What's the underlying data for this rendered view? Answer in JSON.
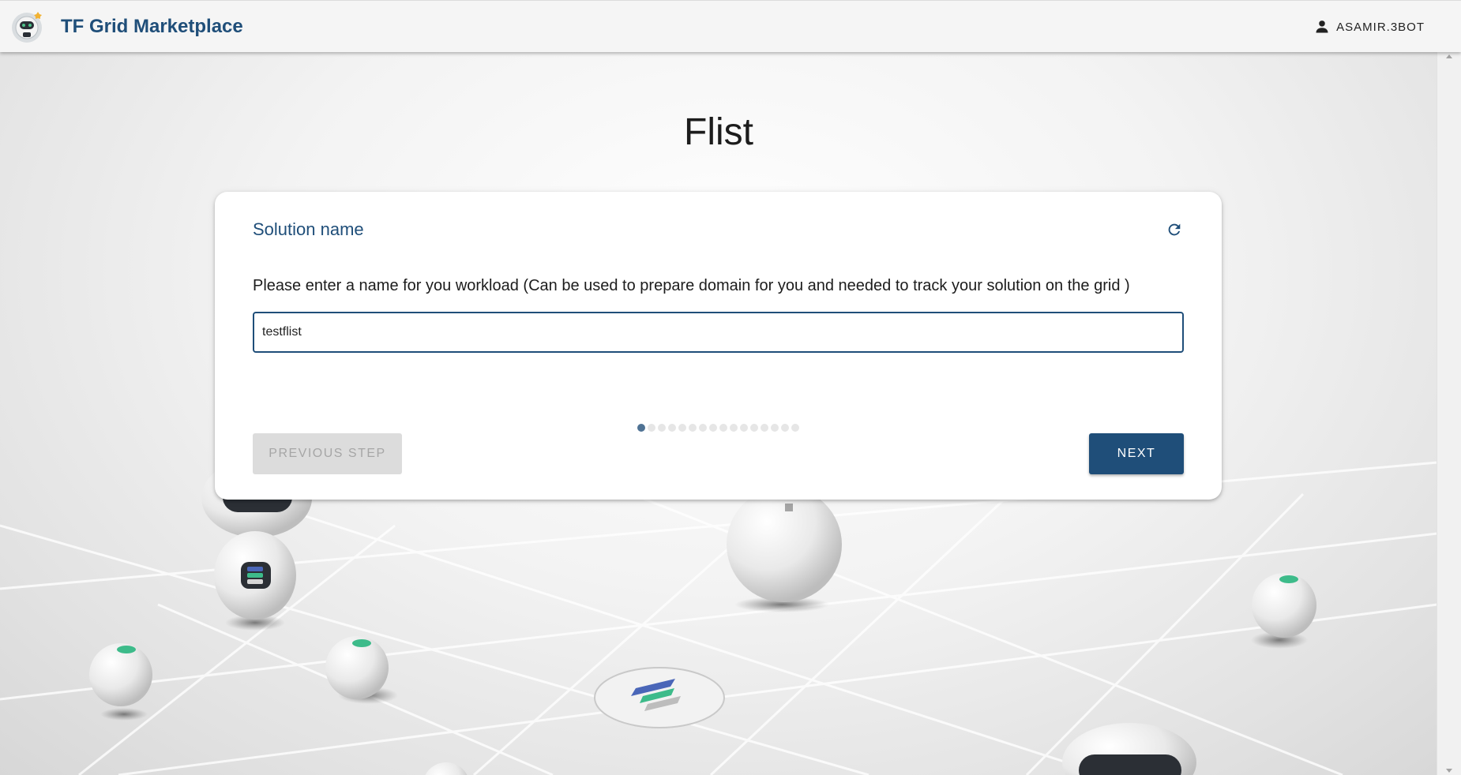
{
  "header": {
    "app_title": "TF Grid Marketplace",
    "user_label": "ASAMIR.3BOT",
    "logo_icon": "robot-logo-icon",
    "user_icon": "person-icon"
  },
  "page": {
    "title": "Flist"
  },
  "step": {
    "title": "Solution name",
    "description": "Please enter a name for you workload (Can be used to prepare domain for you and needed to track your solution on the grid )",
    "input_value": "testflist",
    "refresh_icon": "refresh-icon",
    "total_steps": 16,
    "current_step": 1
  },
  "actions": {
    "previous_label": "PREVIOUS STEP",
    "next_label": "NEXT"
  },
  "colors": {
    "primary": "#1f4e79",
    "disabled_bg": "#dcdcdc",
    "disabled_text": "#a6a6a6",
    "active_dot": "#4f7294",
    "inactive_dot": "#e6e6e6"
  }
}
